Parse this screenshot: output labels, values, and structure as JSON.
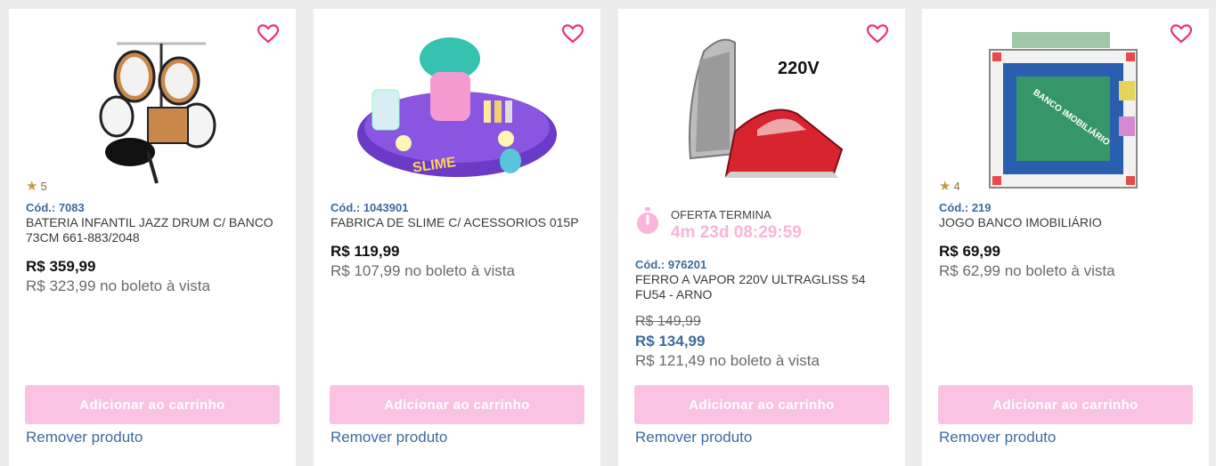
{
  "colors": {
    "accent_pink": "#fbc3e3",
    "link_blue": "#3d6a9e",
    "star_gold": "#c69a3a",
    "heart_pink": "#e8317a"
  },
  "products": [
    {
      "image_alt": "bateria infantil jazz drum",
      "rating": "5",
      "code": "Cód.: 7083",
      "name": "BATERIA INFANTIL JAZZ DRUM C/ BANCO 73CM 661-883/2048",
      "price": "R$ 359,99",
      "boleto": "R$ 323,99 no boleto à vista",
      "add_label": "Adicionar ao carrinho",
      "remove_label": "Remover produto"
    },
    {
      "image_alt": "fabrica de slime",
      "image_text": "SLIME",
      "code": "Cód.: 1043901",
      "name": "FABRICA DE SLIME C/ ACESSORIOS 015P",
      "price": "R$ 119,99",
      "boleto": "R$ 107,99 no boleto à vista",
      "add_label": "Adicionar ao carrinho",
      "remove_label": "Remover produto"
    },
    {
      "image_alt": "ferro a vapor",
      "image_text": "220V",
      "offer_label": "OFERTA TERMINA",
      "offer_timer": "4m 23d 08:29:59",
      "code": "Cód.: 976201",
      "name": "FERRO A VAPOR 220V ULTRAGLISS 54 FU54 - ARNO",
      "old_price": "R$ 149,99",
      "price": "R$ 134,99",
      "boleto": "R$ 121,49 no boleto à vista",
      "add_label": "Adicionar ao carrinho",
      "remove_label": "Remover produto"
    },
    {
      "image_alt": "jogo banco imobiliario",
      "image_text": "BANCO IMOBILIÁRIO",
      "rating": "4",
      "code": "Cód.: 219",
      "name": "JOGO BANCO IMOBILIÁRIO",
      "price": "R$ 69,99",
      "boleto": "R$ 62,99 no boleto à vista",
      "add_label": "Adicionar ao carrinho",
      "remove_label": "Remover produto"
    }
  ]
}
